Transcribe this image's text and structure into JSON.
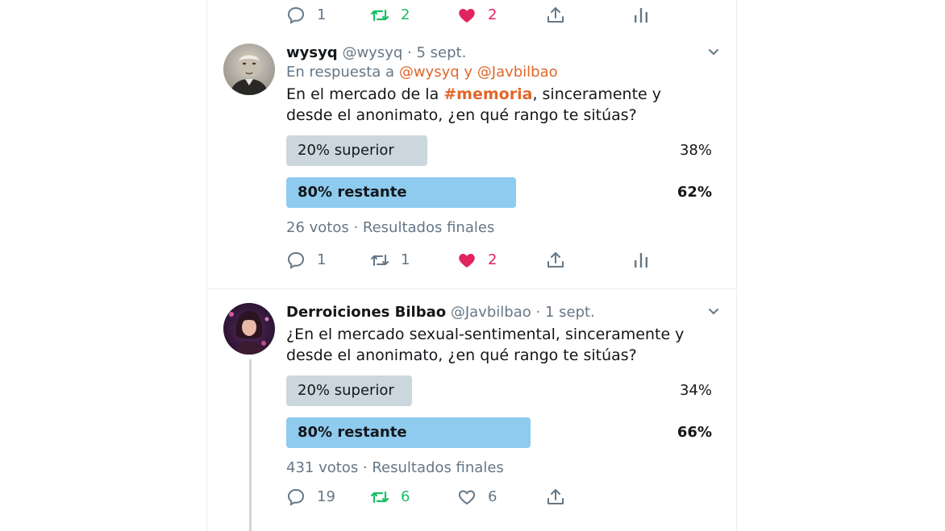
{
  "top_tweet": {
    "actions": {
      "replies": "1",
      "retweets": "2",
      "likes": "2"
    }
  },
  "tweet1": {
    "name": "wysyq",
    "handle": "@wysyq",
    "separator": "·",
    "date": "5 sept.",
    "reply_prefix": "En respuesta a",
    "reply_targets": "@wysyq y @Javbilbao",
    "text_before": "En el mercado de la ",
    "hashtag": "#memoria",
    "text_after": ", sinceramente y desde el anonimato, ¿en qué rango te sitúas?",
    "poll": {
      "options": [
        {
          "label": "20% superior",
          "percent": "38%",
          "fraction": 0.38
        },
        {
          "label": "80% restante",
          "percent": "62%",
          "fraction": 0.62
        }
      ],
      "meta": "26 votos · Resultados finales"
    },
    "actions": {
      "replies": "1",
      "retweets": "1",
      "likes": "2"
    }
  },
  "tweet2": {
    "name": "Derroiciones Bilbao",
    "handle": "@Javbilbao",
    "separator": "·",
    "date": "1 sept.",
    "text": "¿En el mercado sexual-sentimental, sinceramente y desde el anonimato, ¿en qué rango te sitúas?",
    "poll": {
      "options": [
        {
          "label": "20% superior",
          "percent": "34%",
          "fraction": 0.34
        },
        {
          "label": "80% restante",
          "percent": "66%",
          "fraction": 0.66
        }
      ],
      "meta": "431 votos · Resultados finales"
    },
    "actions": {
      "replies": "19",
      "retweets": "6",
      "likes": "6"
    }
  },
  "colors": {
    "accent": "#e0672a",
    "retweet": "#17bf63",
    "like": "#e0245e",
    "muted": "#657786",
    "poll_winner": "#8ecbef",
    "poll_loser": "#ccd6dd"
  },
  "icons": [
    "reply-icon",
    "retweet-icon",
    "like-icon",
    "share-icon",
    "stats-icon",
    "chevron-down-icon"
  ]
}
